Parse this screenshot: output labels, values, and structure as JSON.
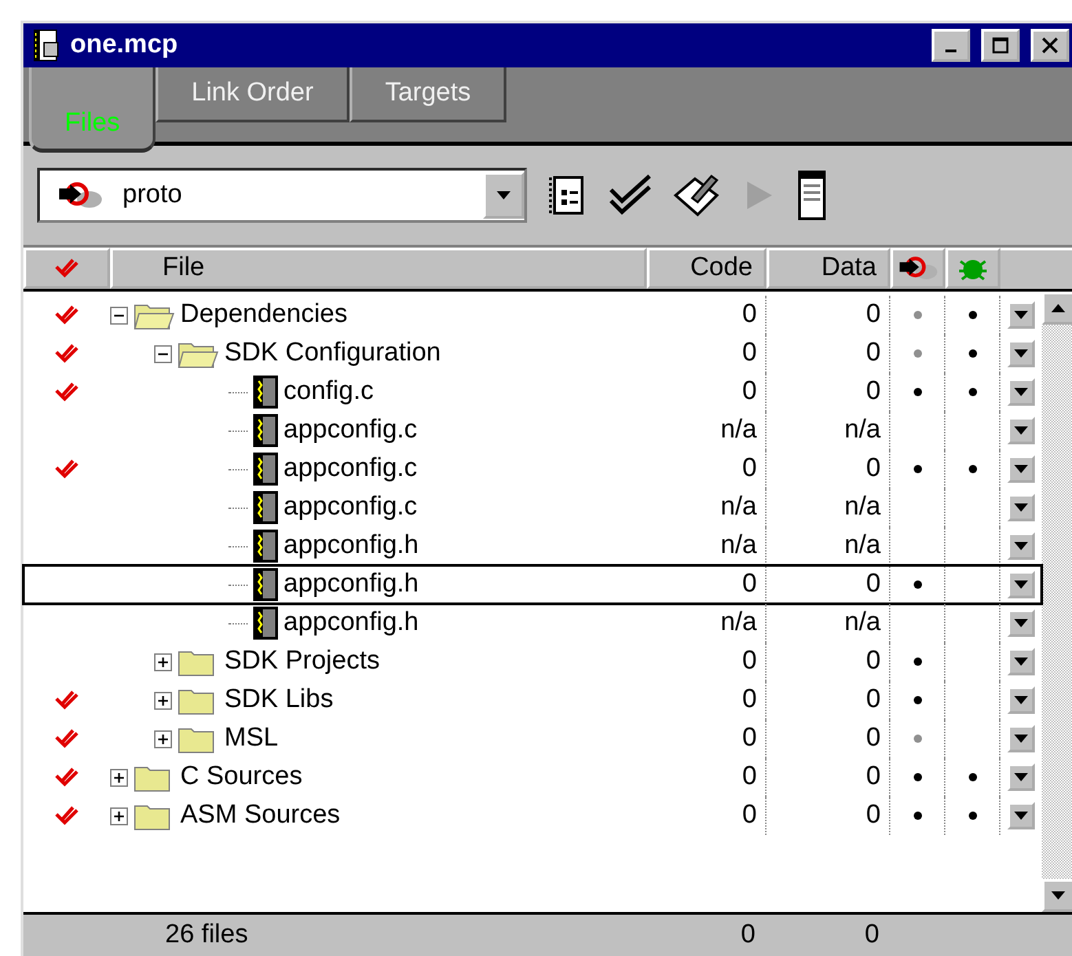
{
  "window": {
    "title": "one.mcp"
  },
  "tabs": [
    {
      "label": "Files",
      "selected": true
    },
    {
      "label": "Link Order",
      "selected": false
    },
    {
      "label": "Targets",
      "selected": false
    }
  ],
  "toolbar": {
    "target": "proto"
  },
  "columns": {
    "file": "File",
    "code": "Code",
    "data": "Data"
  },
  "tree": [
    {
      "kind": "folder",
      "name": "Dependencies",
      "touched": true,
      "expanded": true,
      "code": "0",
      "data": "0",
      "compiled": true,
      "compile_dimmed": true,
      "debug": true,
      "selected": false,
      "children": [
        {
          "kind": "folder",
          "name": "SDK Configuration",
          "touched": true,
          "expanded": true,
          "code": "0",
          "data": "0",
          "compiled": true,
          "compile_dimmed": true,
          "debug": true,
          "selected": false,
          "children": [
            {
              "kind": "file",
              "name": "config.c",
              "touched": true,
              "code": "0",
              "data": "0",
              "compiled": true,
              "compile_dimmed": false,
              "debug": true,
              "selected": false
            },
            {
              "kind": "file",
              "name": "appconfig.c",
              "touched": false,
              "code": "n/a",
              "data": "n/a",
              "compiled": false,
              "debug": false,
              "selected": false
            },
            {
              "kind": "file",
              "name": "appconfig.c",
              "touched": true,
              "code": "0",
              "data": "0",
              "compiled": true,
              "compile_dimmed": false,
              "debug": true,
              "selected": false
            },
            {
              "kind": "file",
              "name": "appconfig.c",
              "touched": false,
              "code": "n/a",
              "data": "n/a",
              "compiled": false,
              "debug": false,
              "selected": false
            },
            {
              "kind": "file",
              "name": "appconfig.h",
              "touched": false,
              "code": "n/a",
              "data": "n/a",
              "compiled": false,
              "debug": false,
              "selected": false
            },
            {
              "kind": "file",
              "name": "appconfig.h",
              "touched": false,
              "code": "0",
              "data": "0",
              "compiled": true,
              "compile_dimmed": false,
              "debug": false,
              "selected": true
            },
            {
              "kind": "file",
              "name": "appconfig.h",
              "touched": false,
              "code": "n/a",
              "data": "n/a",
              "compiled": false,
              "debug": false,
              "selected": false
            }
          ]
        },
        {
          "kind": "folder",
          "name": "SDK Projects",
          "touched": false,
          "expanded": false,
          "code": "0",
          "data": "0",
          "compiled": true,
          "compile_dimmed": false,
          "debug": false,
          "selected": false
        },
        {
          "kind": "folder",
          "name": "SDK Libs",
          "touched": true,
          "expanded": false,
          "code": "0",
          "data": "0",
          "compiled": true,
          "compile_dimmed": false,
          "debug": false,
          "selected": false
        },
        {
          "kind": "folder",
          "name": "MSL",
          "touched": true,
          "expanded": false,
          "code": "0",
          "data": "0",
          "compiled": true,
          "compile_dimmed": true,
          "debug": false,
          "selected": false
        }
      ]
    },
    {
      "kind": "folder",
      "name": "C Sources",
      "touched": true,
      "expanded": false,
      "code": "0",
      "data": "0",
      "compiled": true,
      "compile_dimmed": false,
      "debug": true,
      "selected": false
    },
    {
      "kind": "folder",
      "name": "ASM Sources",
      "touched": true,
      "expanded": false,
      "code": "0",
      "data": "0",
      "compiled": true,
      "compile_dimmed": false,
      "debug": true,
      "selected": false
    }
  ],
  "status_bar": {
    "files": "26 files",
    "code": "0",
    "data": "0"
  }
}
